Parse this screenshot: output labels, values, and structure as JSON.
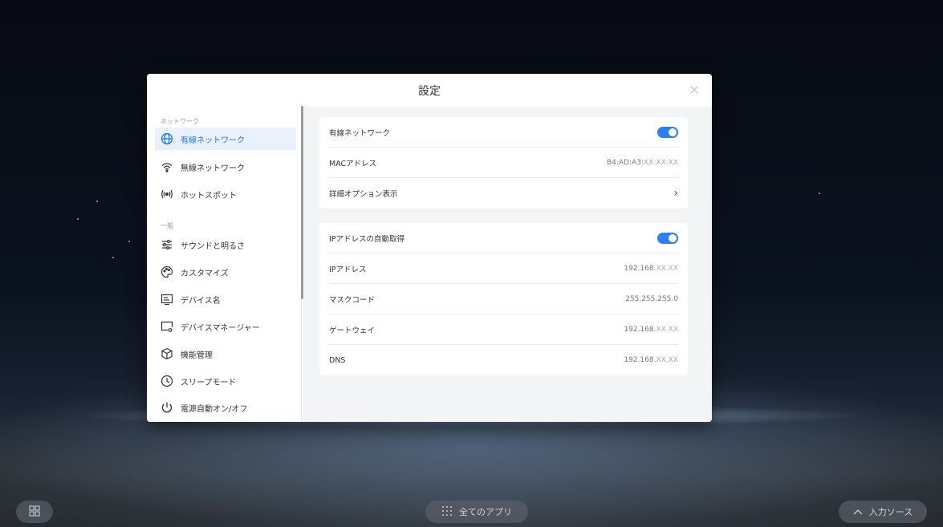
{
  "dialog": {
    "title": "設定",
    "close_icon": "×"
  },
  "sidebar": {
    "sections": [
      {
        "label": "ネットワーク",
        "items": [
          {
            "icon": "globe-icon",
            "label": "有線ネットワーク",
            "active": true
          },
          {
            "icon": "wifi-icon",
            "label": "無線ネットワーク",
            "active": false
          },
          {
            "icon": "hotspot-icon",
            "label": "ホットスポット",
            "active": false
          }
        ]
      },
      {
        "label": "一般",
        "items": [
          {
            "icon": "sliders-icon",
            "label": "サウンドと明るさ",
            "active": false
          },
          {
            "icon": "palette-icon",
            "label": "カスタマイズ",
            "active": false
          },
          {
            "icon": "device-name-icon",
            "label": "デバイス名",
            "active": false
          },
          {
            "icon": "device-manager-icon",
            "label": "デバイスマネージャー",
            "active": false
          },
          {
            "icon": "cube-icon",
            "label": "機能管理",
            "active": false
          },
          {
            "icon": "clock-icon",
            "label": "スリープモード",
            "active": false
          },
          {
            "icon": "power-icon",
            "label": "電源自動オン/オフ",
            "active": false
          }
        ]
      }
    ]
  },
  "content": {
    "card1": {
      "wired_network": {
        "label": "有線ネットワーク",
        "enabled": true
      },
      "mac": {
        "label": "MACアドレス",
        "value_prefix": "B4:AD:A3:",
        "value_masked": "XX:XX:XX"
      },
      "advanced": {
        "label": "詳細オプション表示",
        "chevron": "›"
      }
    },
    "card2": {
      "auto_ip": {
        "label": "IPアドレスの自動取得",
        "enabled": true
      },
      "ip": {
        "label": "IPアドレス",
        "value_prefix": "192.168.",
        "value_masked": "XX.XX"
      },
      "mask": {
        "label": "マスクコード",
        "value": "255.255.255.0"
      },
      "gateway": {
        "label": "ゲートウェイ",
        "value_prefix": "192.168.",
        "value_masked": "XX.XX"
      },
      "dns": {
        "label": "DNS",
        "value_prefix": "192.168.",
        "value_masked": "XX.XX"
      }
    }
  },
  "taskbar": {
    "all_apps": "全てのアプリ",
    "input_source": "入力ソース"
  },
  "colors": {
    "accent": "#2d7ff0",
    "active_bg": "#e8f1fc",
    "active_text": "#2378e8"
  }
}
